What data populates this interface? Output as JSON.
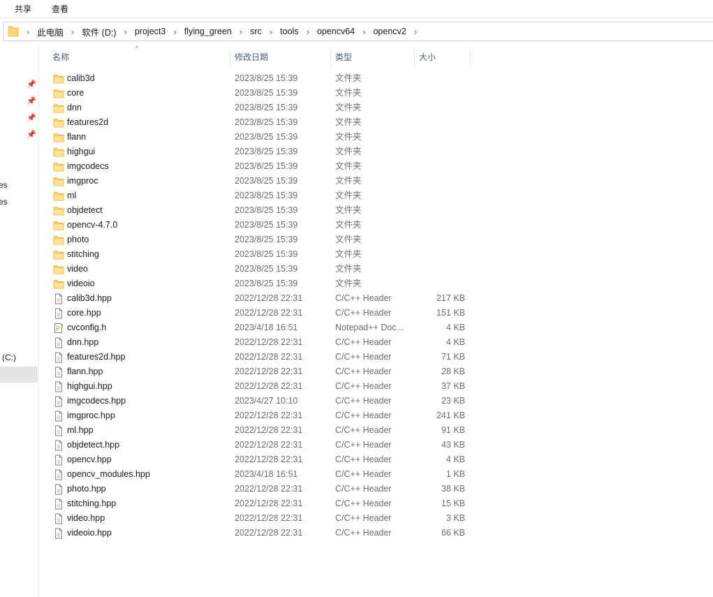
{
  "ribbon": {
    "tabs": [
      "共享",
      "查看"
    ]
  },
  "address": {
    "crumbs": [
      "此电脑",
      "软件 (D:)",
      "project3",
      "flying_green",
      "src",
      "tools",
      "opencv64",
      "opencv2"
    ],
    "separator": "›"
  },
  "nav": {
    "fragments": [
      "es",
      "es",
      "(C:)"
    ]
  },
  "columns": {
    "name": "名称",
    "date": "修改日期",
    "type": "类型",
    "size": "大小"
  },
  "colors": {
    "folder": "#f8d775",
    "folder_dark": "#e8b23a",
    "selected": "#e5e5e5",
    "header_text": "#4c607a"
  },
  "files": [
    {
      "name": "calib3d",
      "date": "2023/8/25 15:39",
      "type": "文件夹",
      "size": "",
      "icon": "folder-icon"
    },
    {
      "name": "core",
      "date": "2023/8/25 15:39",
      "type": "文件夹",
      "size": "",
      "icon": "folder-icon"
    },
    {
      "name": "dnn",
      "date": "2023/8/25 15:39",
      "type": "文件夹",
      "size": "",
      "icon": "folder-icon"
    },
    {
      "name": "features2d",
      "date": "2023/8/25 15:39",
      "type": "文件夹",
      "size": "",
      "icon": "folder-icon"
    },
    {
      "name": "flann",
      "date": "2023/8/25 15:39",
      "type": "文件夹",
      "size": "",
      "icon": "folder-icon"
    },
    {
      "name": "highgui",
      "date": "2023/8/25 15:39",
      "type": "文件夹",
      "size": "",
      "icon": "folder-icon"
    },
    {
      "name": "imgcodecs",
      "date": "2023/8/25 15:39",
      "type": "文件夹",
      "size": "",
      "icon": "folder-icon"
    },
    {
      "name": "imgproc",
      "date": "2023/8/25 15:39",
      "type": "文件夹",
      "size": "",
      "icon": "folder-icon"
    },
    {
      "name": "ml",
      "date": "2023/8/25 15:39",
      "type": "文件夹",
      "size": "",
      "icon": "folder-icon"
    },
    {
      "name": "objdetect",
      "date": "2023/8/25 15:39",
      "type": "文件夹",
      "size": "",
      "icon": "folder-icon"
    },
    {
      "name": "opencv-4.7.0",
      "date": "2023/8/25 15:39",
      "type": "文件夹",
      "size": "",
      "icon": "folder-icon"
    },
    {
      "name": "photo",
      "date": "2023/8/25 15:39",
      "type": "文件夹",
      "size": "",
      "icon": "folder-icon"
    },
    {
      "name": "stitching",
      "date": "2023/8/25 15:39",
      "type": "文件夹",
      "size": "",
      "icon": "folder-icon"
    },
    {
      "name": "video",
      "date": "2023/8/25 15:39",
      "type": "文件夹",
      "size": "",
      "icon": "folder-icon"
    },
    {
      "name": "videoio",
      "date": "2023/8/25 15:39",
      "type": "文件夹",
      "size": "",
      "icon": "folder-icon"
    },
    {
      "name": "calib3d.hpp",
      "date": "2022/12/28 22:31",
      "type": "C/C++ Header",
      "size": "217 KB",
      "icon": "file-icon"
    },
    {
      "name": "core.hpp",
      "date": "2022/12/28 22:31",
      "type": "C/C++ Header",
      "size": "151 KB",
      "icon": "file-icon"
    },
    {
      "name": "cvconfig.h",
      "date": "2023/4/18 16:51",
      "type": "Notepad++ Doc...",
      "size": "4 KB",
      "icon": "notepad-file-icon"
    },
    {
      "name": "dnn.hpp",
      "date": "2022/12/28 22:31",
      "type": "C/C++ Header",
      "size": "4 KB",
      "icon": "file-icon"
    },
    {
      "name": "features2d.hpp",
      "date": "2022/12/28 22:31",
      "type": "C/C++ Header",
      "size": "71 KB",
      "icon": "file-icon"
    },
    {
      "name": "flann.hpp",
      "date": "2022/12/28 22:31",
      "type": "C/C++ Header",
      "size": "28 KB",
      "icon": "file-icon"
    },
    {
      "name": "highgui.hpp",
      "date": "2022/12/28 22:31",
      "type": "C/C++ Header",
      "size": "37 KB",
      "icon": "file-icon"
    },
    {
      "name": "imgcodecs.hpp",
      "date": "2023/4/27 10:10",
      "type": "C/C++ Header",
      "size": "23 KB",
      "icon": "file-icon"
    },
    {
      "name": "imgproc.hpp",
      "date": "2022/12/28 22:31",
      "type": "C/C++ Header",
      "size": "241 KB",
      "icon": "file-icon"
    },
    {
      "name": "ml.hpp",
      "date": "2022/12/28 22:31",
      "type": "C/C++ Header",
      "size": "91 KB",
      "icon": "file-icon"
    },
    {
      "name": "objdetect.hpp",
      "date": "2022/12/28 22:31",
      "type": "C/C++ Header",
      "size": "43 KB",
      "icon": "file-icon"
    },
    {
      "name": "opencv.hpp",
      "date": "2022/12/28 22:31",
      "type": "C/C++ Header",
      "size": "4 KB",
      "icon": "file-icon"
    },
    {
      "name": "opencv_modules.hpp",
      "date": "2023/4/18 16:51",
      "type": "C/C++ Header",
      "size": "1 KB",
      "icon": "file-icon"
    },
    {
      "name": "photo.hpp",
      "date": "2022/12/28 22:31",
      "type": "C/C++ Header",
      "size": "38 KB",
      "icon": "file-icon"
    },
    {
      "name": "stitching.hpp",
      "date": "2022/12/28 22:31",
      "type": "C/C++ Header",
      "size": "15 KB",
      "icon": "file-icon"
    },
    {
      "name": "video.hpp",
      "date": "2022/12/28 22:31",
      "type": "C/C++ Header",
      "size": "3 KB",
      "icon": "file-icon"
    },
    {
      "name": "videoio.hpp",
      "date": "2022/12/28 22:31",
      "type": "C/C++ Header",
      "size": "66 KB",
      "icon": "file-icon"
    }
  ]
}
